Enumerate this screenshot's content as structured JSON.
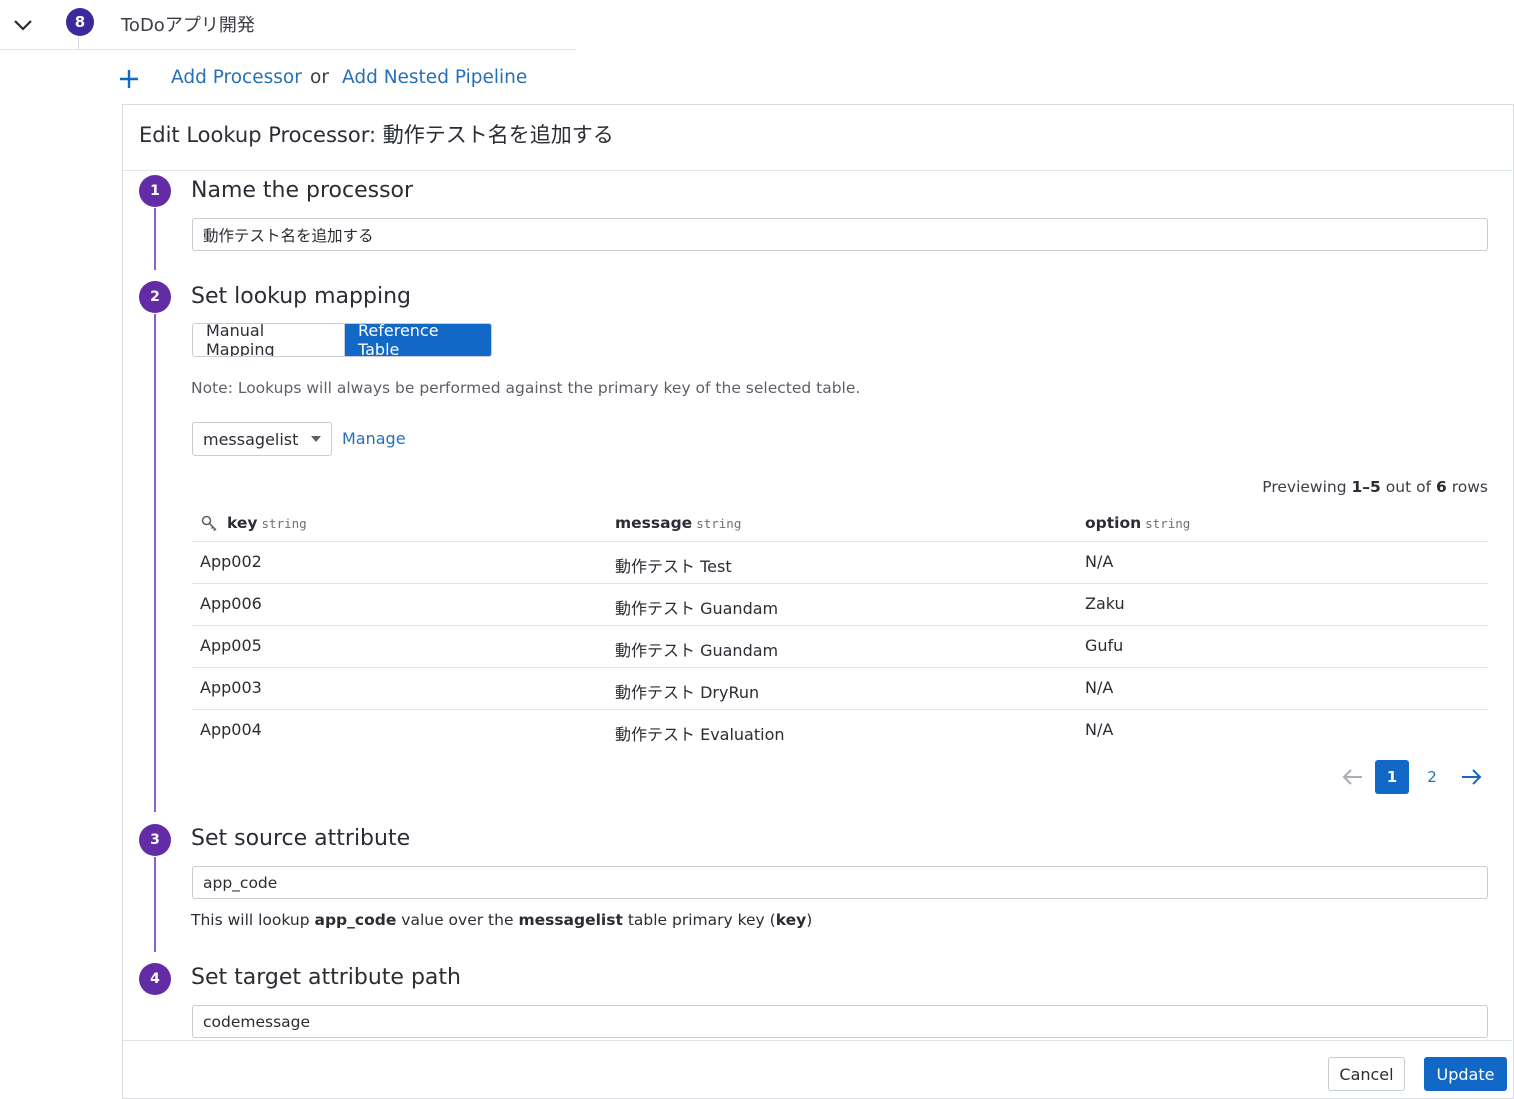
{
  "pipeline": {
    "number": "8",
    "title": "ToDoアプリ開発",
    "add_processor": "Add Processor",
    "or": "or",
    "add_nested_pipeline": "Add Nested Pipeline"
  },
  "panel": {
    "title": "Edit Lookup Processor: 動作テスト名を追加する"
  },
  "steps": [
    {
      "number": "1",
      "title": "Name the processor"
    },
    {
      "number": "2",
      "title": "Set lookup mapping"
    },
    {
      "number": "3",
      "title": "Set source attribute"
    },
    {
      "number": "4",
      "title": "Set target attribute path"
    }
  ],
  "name_input": {
    "value": "動作テスト名を追加する"
  },
  "mapping": {
    "modes": [
      "Manual Mapping",
      "Reference Table"
    ],
    "selected_mode": "Reference Table",
    "note": "Note: Lookups will always be performed against the primary key of the selected table.",
    "table_select": "messagelist",
    "manage_label": "Manage"
  },
  "preview": {
    "prefix": "Previewing",
    "range": "1–5",
    "mid": "out of",
    "total": "6",
    "suffix": "rows"
  },
  "table": {
    "columns": [
      {
        "name": "key",
        "type": "string"
      },
      {
        "name": "message",
        "type": "string"
      },
      {
        "name": "option",
        "type": "string"
      }
    ],
    "rows": [
      [
        "App002",
        "動作テスト Test",
        "N/A"
      ],
      [
        "App006",
        "動作テスト Guandam",
        "Zaku"
      ],
      [
        "App005",
        "動作テスト Guandam",
        "Gufu"
      ],
      [
        "App003",
        "動作テスト DryRun",
        "N/A"
      ],
      [
        "App004",
        "動作テスト Evaluation",
        "N/A"
      ]
    ]
  },
  "pagination": {
    "pages": [
      "1",
      "2"
    ],
    "current": "1"
  },
  "source": {
    "value": "app_code",
    "help_1": "This will lookup",
    "help_attr": "app_code",
    "help_2": "value over the",
    "help_table": "messagelist",
    "help_3": "table primary key (",
    "help_key": "key",
    "help_4": ")"
  },
  "target": {
    "value": "codemessage"
  },
  "footer": {
    "cancel": "Cancel",
    "update": "Update"
  },
  "colors": {
    "accent": "#1168c7",
    "step": "#632ca6",
    "link": "#2670b8"
  }
}
